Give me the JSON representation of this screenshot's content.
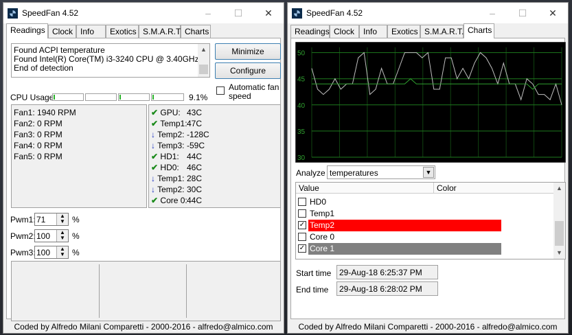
{
  "app_title": "SpeedFan 4.52",
  "titlebar_buttons": {
    "minimize": "–",
    "maximize": "☐",
    "close": "✕"
  },
  "tabs": [
    "Readings",
    "Clock",
    "Info",
    "Exotics",
    "S.M.A.R.T.",
    "Charts"
  ],
  "footer": "Coded by Alfredo Milani Comparetti - 2000-2016 - alfredo@almico.com",
  "readings": {
    "log_lines": [
      "Found ACPI temperature",
      "Found Intel(R) Core(TM) i3-3240 CPU @ 3.40GHz",
      "End of detection"
    ],
    "minimize_label": "Minimize",
    "configure_label": "Configure",
    "auto_fan_label": "Automatic fan speed",
    "auto_fan_line1": "Automatic fan",
    "auto_fan_line2": "speed",
    "auto_fan_checked": false,
    "cpu_usage_label": "CPU Usage",
    "cpu_usage_value": "9.1%",
    "cpu_core_usage_fractions": [
      0.03,
      0.0,
      0.03,
      0.02
    ],
    "fans": [
      "Fan1: 1940 RPM",
      "Fan2: 0 RPM",
      "Fan3: 0 RPM",
      "Fan4: 0 RPM",
      "Fan5: 0 RPM"
    ],
    "temps": [
      {
        "status": "ok",
        "name": "GPU:",
        "value": "43C"
      },
      {
        "status": "ok",
        "name": "Temp1:",
        "value": "47C"
      },
      {
        "status": "down",
        "name": "Temp2:",
        "value": "-128C"
      },
      {
        "status": "down",
        "name": "Temp3:",
        "value": "-59C"
      },
      {
        "status": "ok",
        "name": "HD1:",
        "value": "44C"
      },
      {
        "status": "ok",
        "name": "HD0:",
        "value": "46C"
      },
      {
        "status": "down",
        "name": "Temp1:",
        "value": "28C"
      },
      {
        "status": "down",
        "name": "Temp2:",
        "value": "30C"
      },
      {
        "status": "ok",
        "name": "Core 0:",
        "value": "44C"
      }
    ],
    "pwms": [
      {
        "label": "Pwm1:",
        "value": "71",
        "unit": "%"
      },
      {
        "label": "Pwm2:",
        "value": "100",
        "unit": "%"
      },
      {
        "label": "Pwm3:",
        "value": "100",
        "unit": "%"
      }
    ],
    "status_icons": {
      "ok": "✔",
      "down": "↓"
    }
  },
  "charts": {
    "analyze_label": "Analyze",
    "analyze_value": "temperatures",
    "list_headers": {
      "value": "Value",
      "color": "Color"
    },
    "list_items": [
      {
        "label": "HD0",
        "checked": false,
        "color": ""
      },
      {
        "label": "Temp1",
        "checked": false,
        "color": ""
      },
      {
        "label": "Temp2",
        "checked": true,
        "color": "#ff0000"
      },
      {
        "label": "Core 0",
        "checked": false,
        "color": ""
      },
      {
        "label": "Core 1",
        "checked": true,
        "color": "#808080"
      }
    ],
    "start_time_label": "Start time",
    "start_time_value": "29-Aug-18 6:25:37 PM",
    "end_time_label": "End time",
    "end_time_value": "29-Aug-18 6:28:02 PM",
    "checkbox_mark": "✓"
  },
  "chart_data": {
    "type": "line",
    "y_ticks": [
      "50",
      "45",
      "40",
      "35",
      "30"
    ],
    "ylim": [
      30,
      51
    ],
    "grid": true,
    "background_color": "#000000",
    "grid_color": "#1e7a1e",
    "series": [
      {
        "color": "#c0c0c0",
        "values": [
          47,
          43,
          42,
          43,
          45,
          43,
          44,
          44,
          49,
          50,
          42,
          43,
          47,
          44,
          44,
          47,
          50,
          50,
          50,
          49,
          50,
          43,
          43,
          49,
          49,
          45,
          47,
          45,
          48,
          50,
          49,
          47,
          44,
          48,
          44,
          44,
          41,
          45,
          44,
          42,
          42,
          41,
          44,
          40
        ]
      },
      {
        "color": "#2fa02f",
        "values": [
          44,
          44,
          44,
          44,
          44,
          44,
          44,
          44,
          44,
          44,
          44,
          44,
          44,
          44,
          44,
          44,
          44,
          45,
          44,
          44,
          44,
          44,
          44,
          44,
          44,
          44,
          44,
          44,
          44,
          44,
          44,
          44,
          44,
          44,
          44,
          44,
          44,
          44,
          43,
          44,
          44,
          44,
          44,
          44
        ]
      }
    ]
  }
}
